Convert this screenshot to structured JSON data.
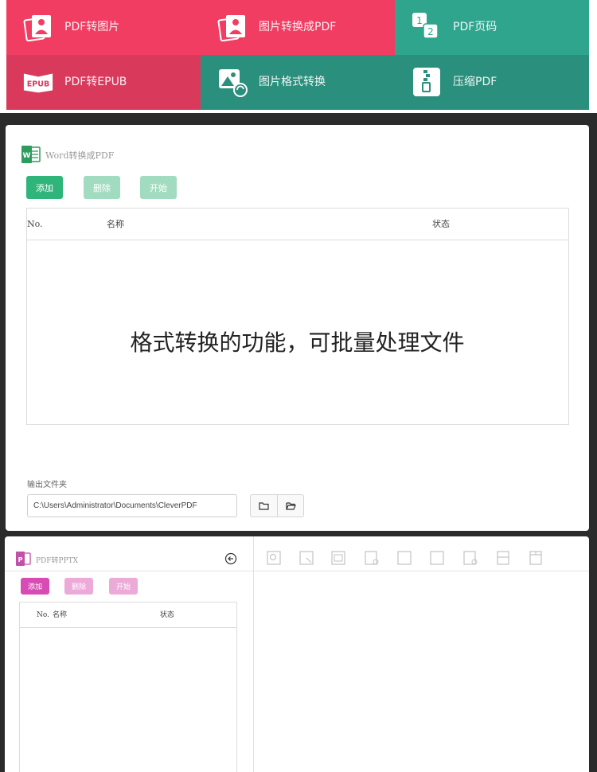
{
  "tiles": [
    {
      "label": "PDF转图片",
      "icon": "pdf-to-image-icon"
    },
    {
      "label": "图片转换成PDF",
      "icon": "image-to-pdf-icon"
    },
    {
      "label": "PDF页码",
      "icon": "page-number-icon"
    },
    {
      "label": "PDF转EPUB",
      "icon": "epub-icon"
    },
    {
      "label": "图片格式转换",
      "icon": "image-convert-icon"
    },
    {
      "label": "压缩PDF",
      "icon": "zip-icon"
    }
  ],
  "word_panel": {
    "title": "Word转换成PDF",
    "buttons": {
      "add": "添加",
      "delete": "删除",
      "start": "开始"
    },
    "columns": {
      "no": "No.",
      "name": "名称",
      "status": "状态"
    },
    "overlay_text": "格式转换的功能，可批量处理文件",
    "output_label": "输出文件夹",
    "output_path": "C:\\Users\\Administrator\\Documents\\CleverPDF"
  },
  "pptx_panel": {
    "title": "PDF转PPTX",
    "buttons": {
      "add": "添加",
      "delete": "删除",
      "start": "开始"
    },
    "columns": {
      "no": "No.",
      "name": "名称",
      "status": "状态"
    }
  },
  "colors": {
    "pink": "#f23d63",
    "teal": "#2fa58e",
    "green_btn": "#2fb57a",
    "magenta_btn": "#d94bb4"
  }
}
